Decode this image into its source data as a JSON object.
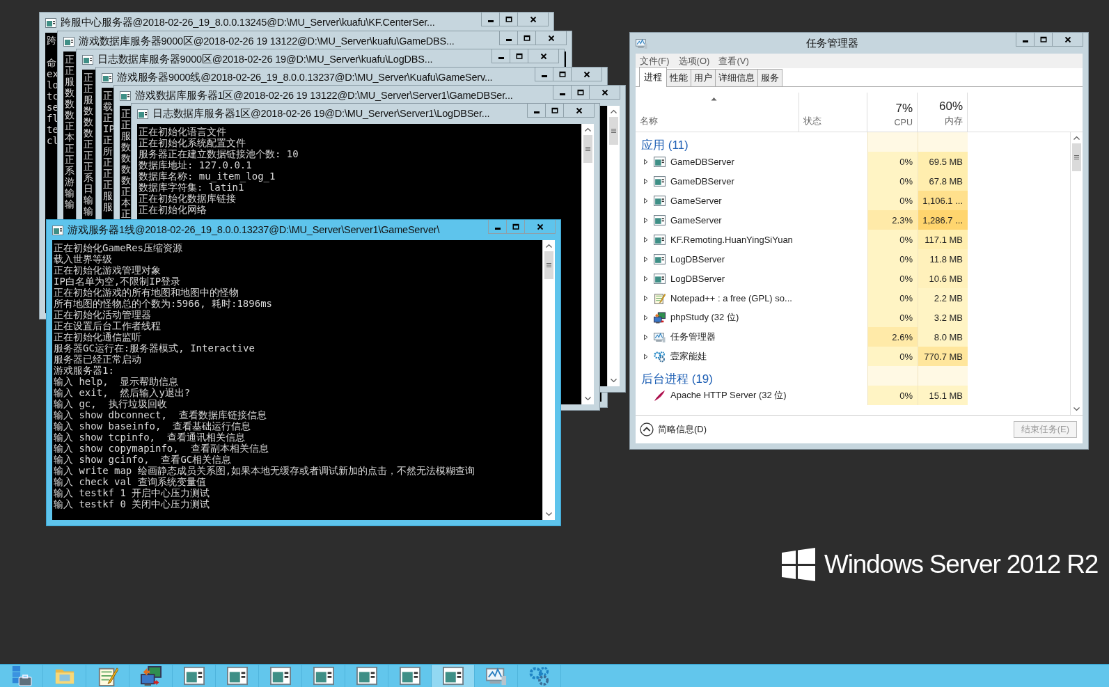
{
  "console_windows": [
    {
      "title": "跨服中心服务器@2018-02-26_19_8.0.0.13245@D:\\MU_Server\\kuafu\\KF.CenterSer...",
      "kind": "stacked",
      "active": false,
      "lines": [
        "跨",
        {
          "kind": "spaced",
          "text": "命"
        },
        "ex",
        "lo",
        "tc",
        "se",
        "fl",
        "te",
        "cl"
      ]
    },
    {
      "title": "游戏数据库服务器9000区@2018-02-26 19 13122@D:\\MU_Server\\kuafu\\GameDBS...",
      "kind": "stacked",
      "active": false,
      "lines": [
        "正",
        "正",
        "服",
        "数",
        "数",
        "数",
        "正",
        "本",
        "正",
        "正",
        "系",
        "游",
        "输",
        "输"
      ]
    },
    {
      "title": "日志数据库服务器9000区@2018-02-26 19@D:\\MU_Server\\kuafu\\LogDBS...",
      "kind": "stacked",
      "active": false,
      "lines": [
        "正",
        "正",
        "服",
        "数",
        "数",
        "数",
        "正",
        "正",
        "正",
        "系",
        "日",
        "输",
        "输"
      ]
    },
    {
      "title": "游戏服务器9000线@2018-02-26_19_8.0.0.13237@D:\\MU_Server\\Kuafu\\GameServ...",
      "kind": "stacked",
      "active": false,
      "lines": [
        "正",
        "载",
        "正",
        "IP",
        "正",
        "所",
        "正",
        "正",
        "正",
        "服",
        "服"
      ]
    },
    {
      "title": "游戏数据库服务器1区@2018-02-26 19 13122@D:\\MU_Server\\Server1\\GameDBSer...",
      "kind": "console",
      "active": false,
      "lines": [
        "正",
        "正",
        "服",
        "数",
        "数",
        "数",
        "数",
        "正",
        "本",
        "正"
      ]
    },
    {
      "title": "日志数据库服务器1区@2018-02-26 19@D:\\MU_Server\\Server1\\LogDBSer...",
      "kind": "console",
      "active": false,
      "lines": [
        "正在初始化语言文件",
        "正在初始化系统配置文件",
        "服务器正在建立数据链接池个数: 10",
        "数据库地址: 127.0.0.1",
        "数据库名称: mu_item_log_1",
        "数据库字符集: latin1",
        "正在初始化数据库链接",
        "正在初始化网络"
      ]
    },
    {
      "title": "游戏服务器1线@2018-02-26_19_8.0.0.13237@D:\\MU_Server\\Server1\\GameServer\\",
      "kind": "console",
      "active": true,
      "lines": [
        "正在初始化GameRes压缩资源",
        "载入世界等级",
        "正在初始化游戏管理对象",
        "IP白名单为空,不限制IP登录",
        "正在初始化游戏的所有地图和地图中的怪物",
        "所有地图的怪物总的个数为:5966, 耗时:1896ms",
        "正在初始化活动管理器",
        "正在设置后台工作者线程",
        "正在初始化通信监听",
        "服务器GC运行在:服务器模式, Interactive",
        "服务器已经正常启动",
        "游戏服务器1:",
        "输入 help,  显示帮助信息",
        "输入 exit,  然后输入y退出?",
        "输入 gc,  执行垃圾回收",
        "输入 show dbconnect,  查看数据库链接信息",
        "输入 show baseinfo,  查看基础运行信息",
        "输入 show tcpinfo,  查看通讯相关信息",
        "输入 show copymapinfo,  查看副本相关信息",
        "输入 show gcinfo,  查看GC相关信息",
        "输入 write map 绘画静态成员关系图,如果本地无缓存或者调试新加的点击，不然无法模糊查询",
        "输入 check val 查询系统变量值",
        "输入 testkf 1 开启中心压力测试",
        "输入 testkf 0 关闭中心压力测试"
      ]
    }
  ],
  "task_manager": {
    "title": "任务管理器",
    "menu": [
      "文件(F)",
      "选项(O)",
      "查看(V)"
    ],
    "tabs": [
      {
        "label": "进程",
        "selected": true
      },
      {
        "label": "性能",
        "selected": false
      },
      {
        "label": "用户",
        "selected": false
      },
      {
        "label": "详细信息",
        "selected": false
      },
      {
        "label": "服务",
        "selected": false
      }
    ],
    "columns": {
      "name": "名称",
      "status": "状态",
      "cpu_total": "7%",
      "cpu": "CPU",
      "memory_total": "60%",
      "memory": "内存"
    },
    "groups": [
      {
        "title": "应用 (11)",
        "rows": [
          {
            "kind": "console",
            "name": "GameDBServer",
            "expanded": false,
            "cpu": {
              "text": "0%",
              "color": "#fff4c4"
            },
            "memory": {
              "text": "69.5 MB",
              "color": "#ffeeae"
            }
          },
          {
            "kind": "console",
            "name": "GameDBServer",
            "expanded": false,
            "cpu": {
              "text": "0%",
              "color": "#fff4c4"
            },
            "memory": {
              "text": "67.8 MB",
              "color": "#ffeeae"
            }
          },
          {
            "kind": "console",
            "name": "GameServer",
            "expanded": false,
            "cpu": {
              "text": "0%",
              "color": "#fff4c4"
            },
            "memory": {
              "text": "1,106.1 ...",
              "color": "#ffe08c"
            }
          },
          {
            "kind": "console",
            "name": "GameServer",
            "expanded": false,
            "cpu": {
              "text": "2.3%",
              "color": "#ffeaa8"
            },
            "memory": {
              "text": "1,286.7 ...",
              "color": "#ffd56e"
            }
          },
          {
            "kind": "console",
            "name": "KF.Remoting.HuanYingSiYuan",
            "expanded": false,
            "cpu": {
              "text": "0%",
              "color": "#fff4c4"
            },
            "memory": {
              "text": "117.1 MB",
              "color": "#ffeeae"
            }
          },
          {
            "kind": "console",
            "name": "LogDBServer",
            "expanded": false,
            "cpu": {
              "text": "0%",
              "color": "#fff4c4"
            },
            "memory": {
              "text": "11.8 MB",
              "color": "#fff1bb"
            }
          },
          {
            "kind": "console",
            "name": "LogDBServer",
            "expanded": false,
            "cpu": {
              "text": "0%",
              "color": "#fff4c4"
            },
            "memory": {
              "text": "10.6 MB",
              "color": "#fff1bb"
            }
          },
          {
            "kind": "notepad",
            "name": "Notepad++ : a free (GPL) so...",
            "expanded": false,
            "cpu": {
              "text": "0%",
              "color": "#fff4c4"
            },
            "memory": {
              "text": "2.2 MB",
              "color": "#fff4c4"
            }
          },
          {
            "kind": "computers",
            "name": "phpStudy (32 位)",
            "expanded": false,
            "cpu": {
              "text": "0%",
              "color": "#fff4c4"
            },
            "memory": {
              "text": "3.2 MB",
              "color": "#fff4c4"
            }
          },
          {
            "kind": "monitor",
            "name": "任务管理器",
            "expanded": false,
            "cpu": {
              "text": "2.6%",
              "color": "#ffeaa8"
            },
            "memory": {
              "text": "8.0 MB",
              "color": "#fff4c4"
            }
          },
          {
            "kind": "gears",
            "name": "壹家能娃",
            "expanded": false,
            "cpu": {
              "text": "0%",
              "color": "#fff4c4"
            },
            "memory": {
              "text": "770.7 MB",
              "color": "#ffe69c"
            }
          }
        ]
      },
      {
        "title": "后台进程 (19)",
        "rows": [
          {
            "kind": "feather",
            "name": "Apache HTTP Server (32 位)",
            "cpu": {
              "text": "0%",
              "color": "#fff4c4"
            },
            "memory": {
              "text": "15.1 MB",
              "color": "#fff4c4"
            }
          }
        ]
      }
    ],
    "footer": {
      "details": "简略信息(D)",
      "end_task": {
        "label": "结束任务(E)",
        "disabled": true
      }
    }
  },
  "branding": {
    "text": "Windows Server 2012 R2"
  },
  "taskbar": [
    {
      "kind": "server",
      "selected": false
    },
    {
      "kind": "folder",
      "selected": false
    },
    {
      "kind": "notepad",
      "selected": false
    },
    {
      "kind": "computers",
      "selected": false
    },
    {
      "kind": "console",
      "selected": false
    },
    {
      "kind": "console",
      "selected": false
    },
    {
      "kind": "console",
      "selected": false
    },
    {
      "kind": "console",
      "selected": false
    },
    {
      "kind": "console",
      "selected": false
    },
    {
      "kind": "console",
      "selected": false
    },
    {
      "kind": "console",
      "selected": true
    },
    {
      "kind": "monitor",
      "selected": false
    },
    {
      "kind": "gears",
      "selected": false
    }
  ]
}
